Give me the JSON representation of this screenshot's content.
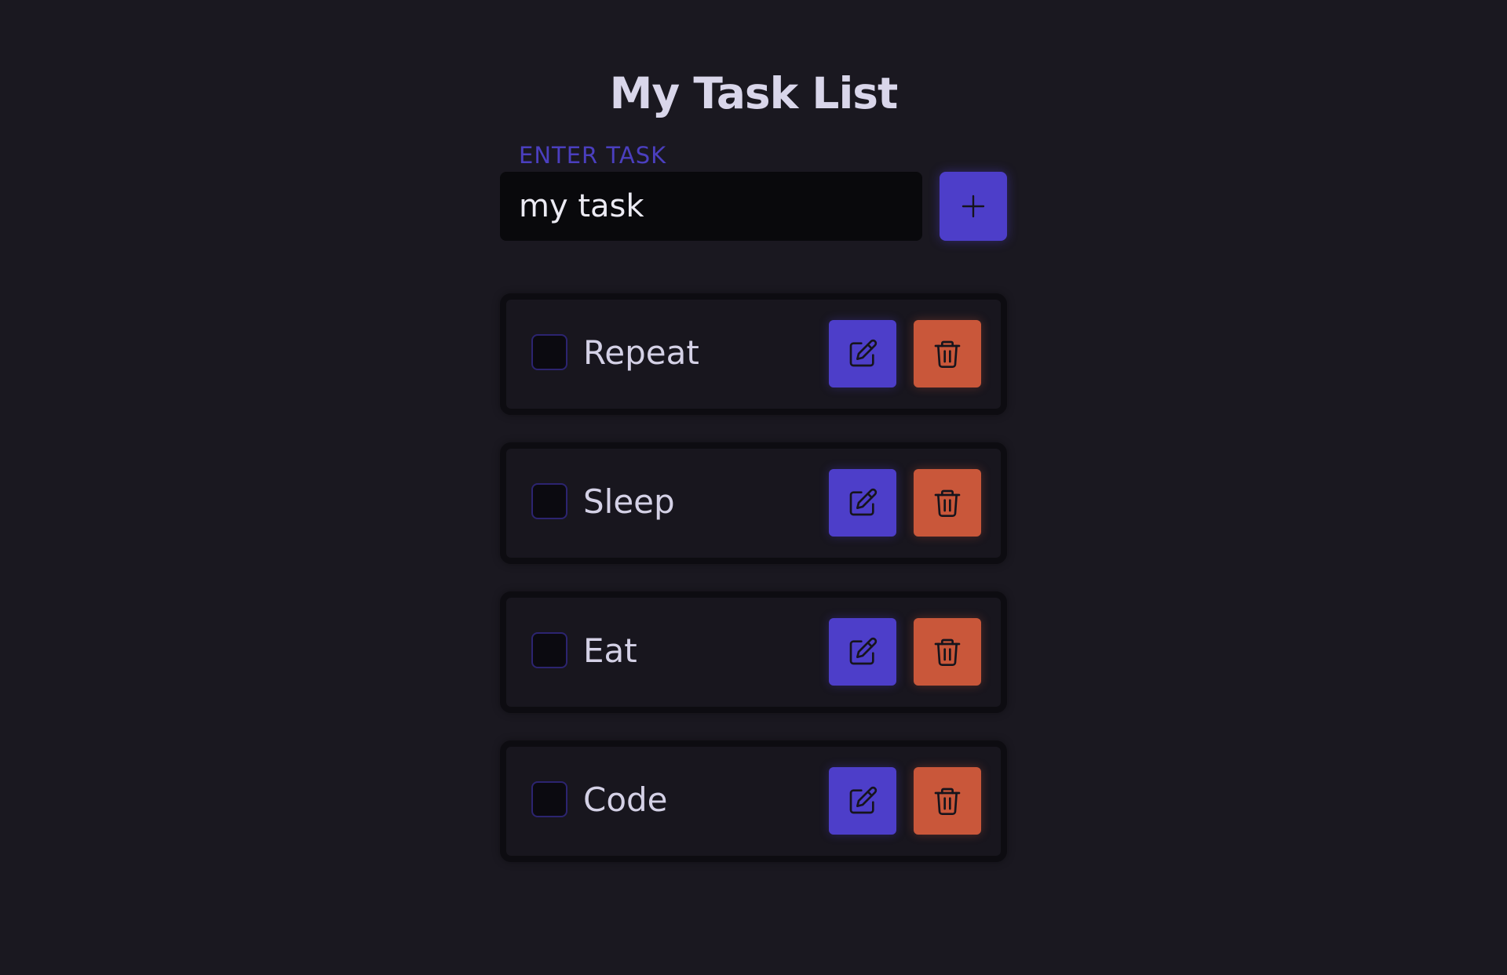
{
  "page": {
    "title": "My Task List"
  },
  "form": {
    "label": "ENTER TASK",
    "input_value": "my task",
    "add_icon": "plus-icon"
  },
  "tasks": [
    {
      "label": "Repeat",
      "checked": false,
      "edit_icon": "pencil-square-icon",
      "delete_icon": "trash-icon"
    },
    {
      "label": "Sleep",
      "checked": false,
      "edit_icon": "pencil-square-icon",
      "delete_icon": "trash-icon"
    },
    {
      "label": "Eat",
      "checked": false,
      "edit_icon": "pencil-square-icon",
      "delete_icon": "trash-icon"
    },
    {
      "label": "Code",
      "checked": false,
      "edit_icon": "pencil-square-icon",
      "delete_icon": "trash-icon"
    }
  ],
  "colors": {
    "background": "#1a1820",
    "accent": "#4d3ec9",
    "danger": "#c9573a",
    "label": "#4b3fbf"
  }
}
